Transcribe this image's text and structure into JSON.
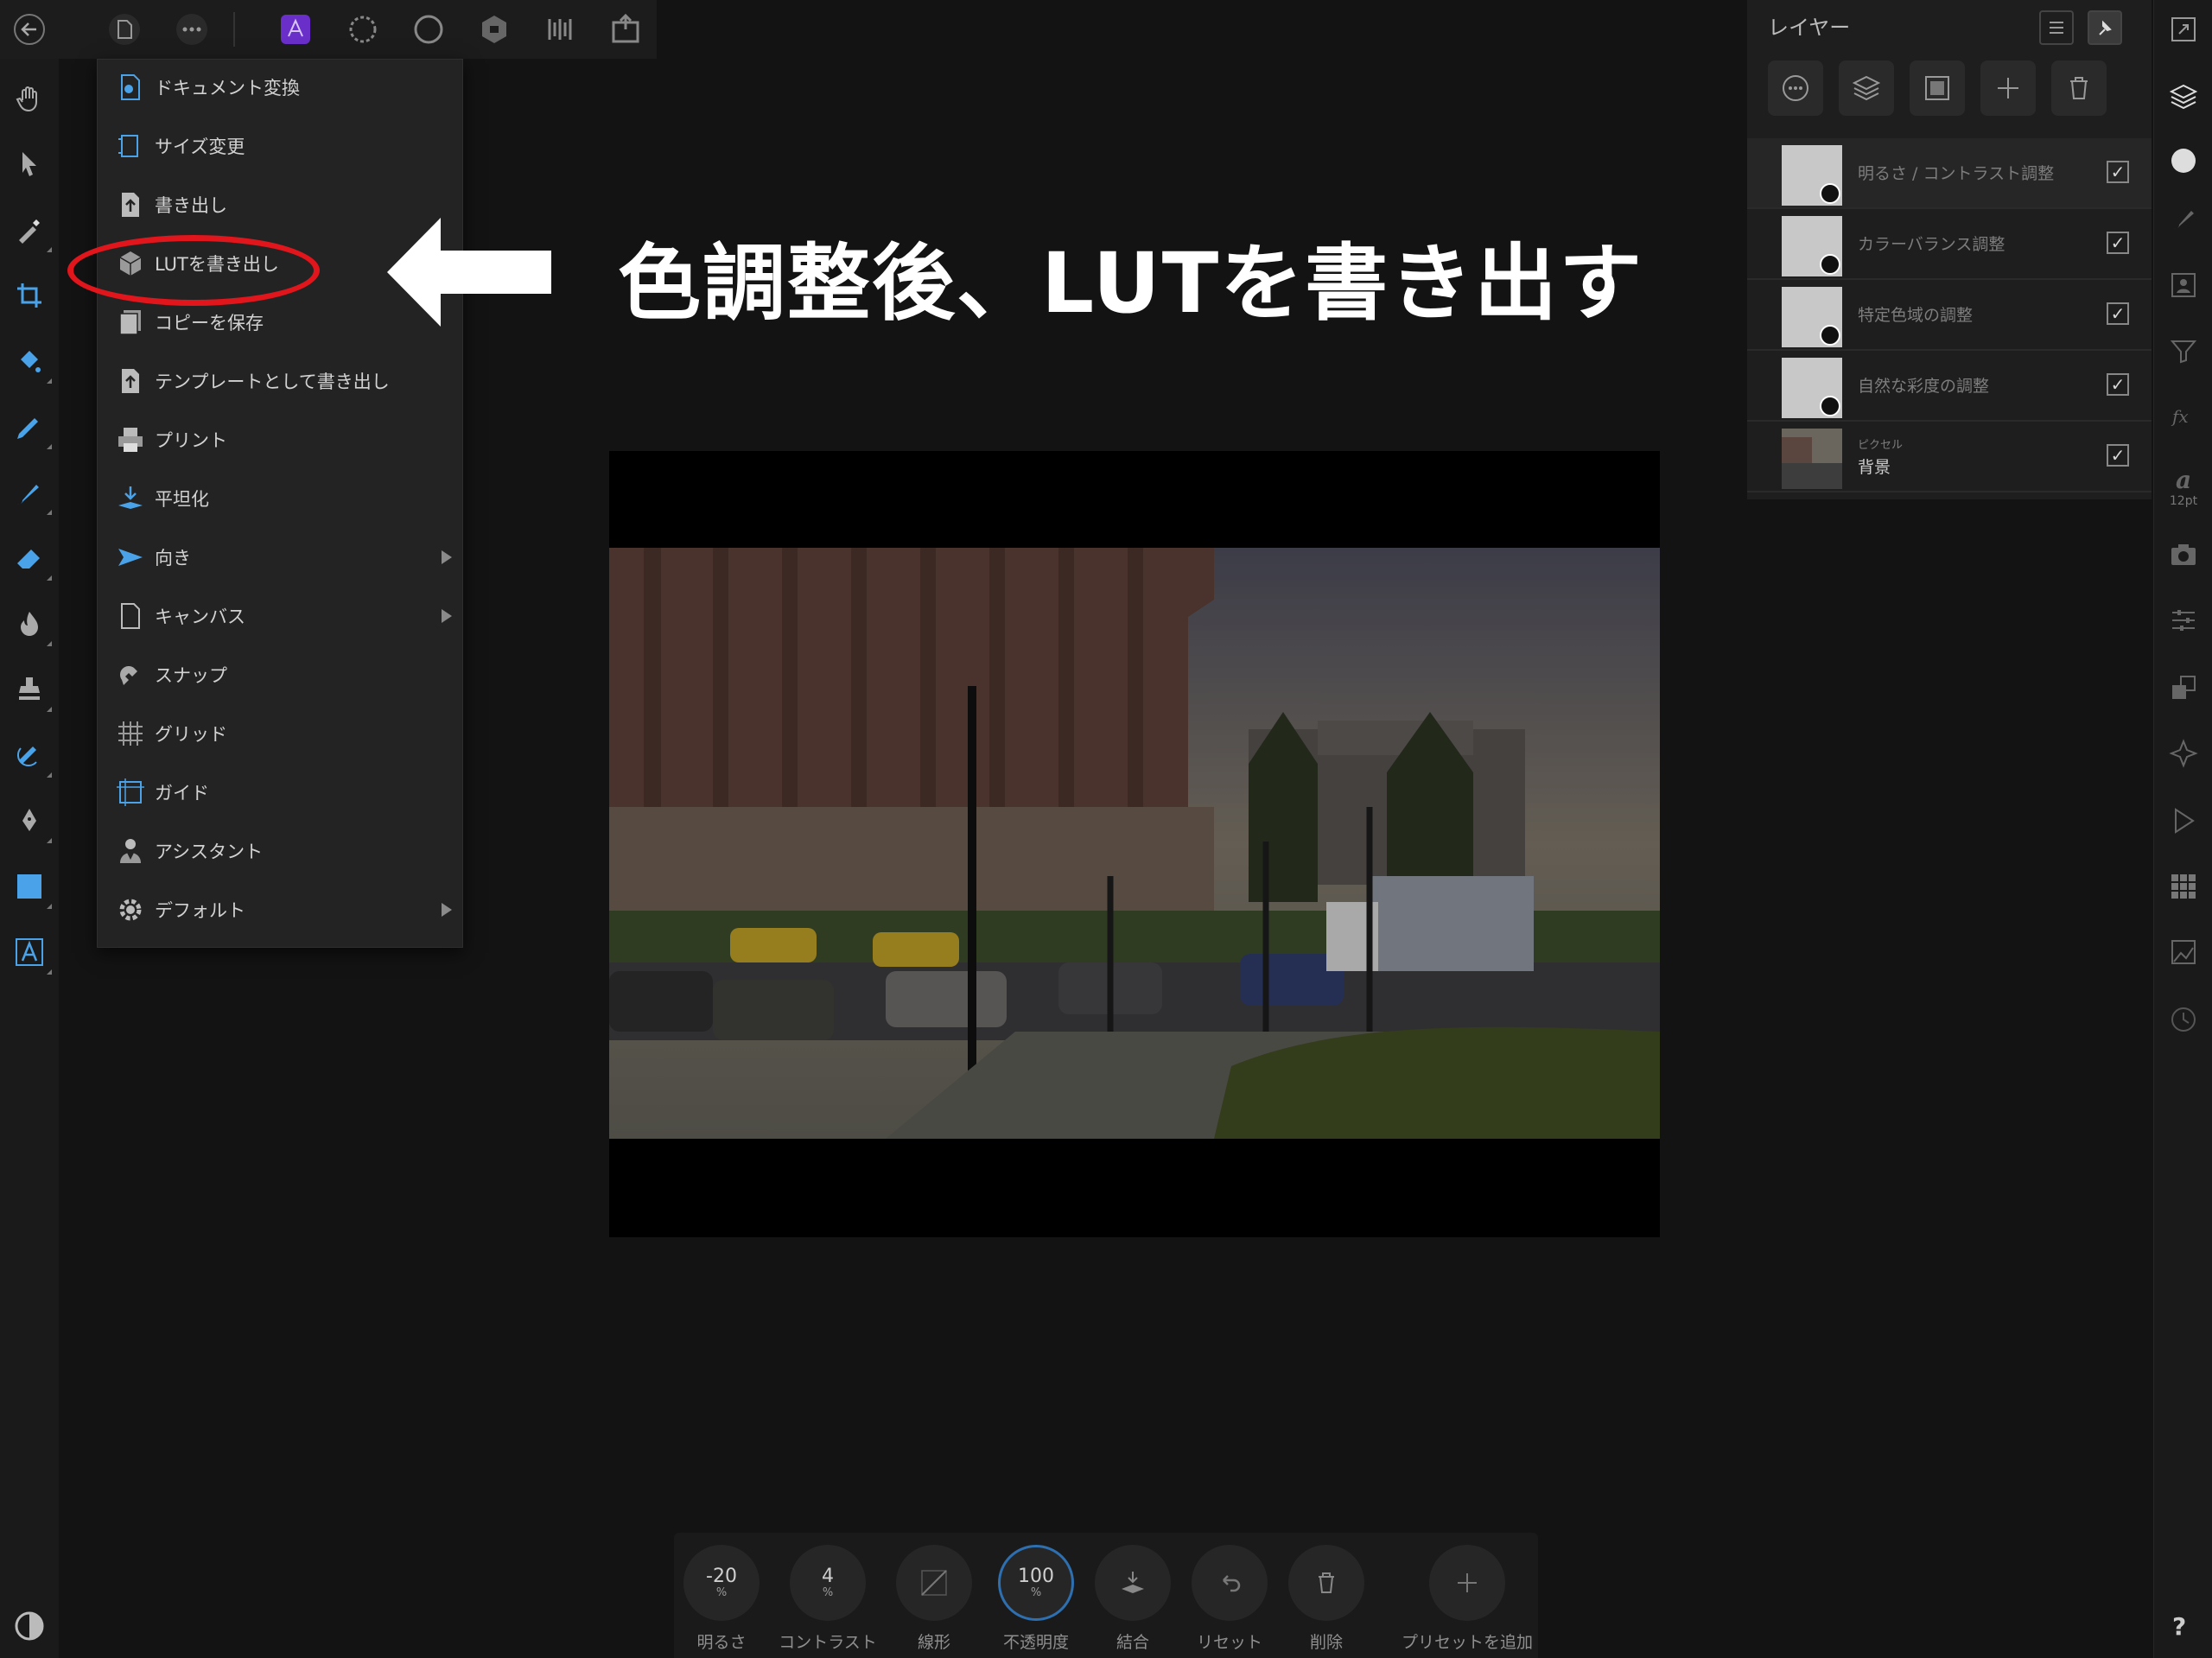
{
  "annotation": {
    "text": "色調整後、LUTを書き出す",
    "circle_color": "#e0161c",
    "arrow_color": "#ffffff"
  },
  "top_toolbar": {
    "items": [
      "back-arrow-icon",
      "document-icon",
      "more-icon",
      "photo-persona-icon",
      "liquify-persona-icon",
      "develop-persona-icon",
      "tone-mapping-persona-icon",
      "export-persona-icon",
      "share-icon"
    ],
    "accent_color": "#7b3fd0"
  },
  "document_menu": {
    "items": [
      {
        "label": "ドキュメント変換",
        "icon": "convert-document-icon",
        "submenu": false
      },
      {
        "label": "サイズ変更",
        "icon": "resize-icon",
        "submenu": false
      },
      {
        "label": "書き出し",
        "icon": "export-icon",
        "submenu": false
      },
      {
        "label": "LUTを書き出し",
        "icon": "lut-cube-icon",
        "submenu": false
      },
      {
        "label": "コピーを保存",
        "icon": "save-copy-icon",
        "submenu": false
      },
      {
        "label": "テンプレートとして書き出し",
        "icon": "export-template-icon",
        "submenu": false
      },
      {
        "label": "プリント",
        "icon": "printer-icon",
        "submenu": false
      },
      {
        "label": "平坦化",
        "icon": "flatten-icon",
        "submenu": false
      },
      {
        "label": "向き",
        "icon": "orientation-icon",
        "submenu": true
      },
      {
        "label": "キャンバス",
        "icon": "canvas-icon",
        "submenu": true
      },
      {
        "label": "スナップ",
        "icon": "snap-icon",
        "submenu": false
      },
      {
        "label": "グリッド",
        "icon": "grid-icon",
        "submenu": false
      },
      {
        "label": "ガイド",
        "icon": "guides-icon",
        "submenu": false
      },
      {
        "label": "アシスタント",
        "icon": "assistant-icon",
        "submenu": false
      },
      {
        "label": "デフォルト",
        "icon": "gear-icon",
        "submenu": true
      }
    ]
  },
  "layers_panel": {
    "title": "レイヤー",
    "layers": [
      {
        "name": "明るさ / コントラスト調整",
        "kind": "adjustment",
        "visible": true,
        "selected": true
      },
      {
        "name": "カラーバランス調整",
        "kind": "adjustment",
        "visible": true,
        "selected": false
      },
      {
        "name": "特定色域の調整",
        "kind": "adjustment",
        "visible": true,
        "selected": false
      },
      {
        "name": "自然な彩度の調整",
        "kind": "adjustment",
        "visible": true,
        "selected": false
      },
      {
        "name": "背景",
        "type_label": "ピクセル",
        "kind": "pixel",
        "visible": true,
        "selected": false
      }
    ],
    "checkmark": "✓"
  },
  "right_studio": {
    "text_size_label": "12pt",
    "help_label": "?"
  },
  "context_toolbar": {
    "items": [
      {
        "value": "-20",
        "unit": "%",
        "label": "明るさ",
        "active": false
      },
      {
        "value": "4",
        "unit": "%",
        "label": "コントラスト",
        "active": false
      },
      {
        "value": "",
        "unit": "",
        "label": "線形",
        "active": false
      },
      {
        "value": "100",
        "unit": "%",
        "label": "不透明度",
        "active": true
      },
      {
        "value": "",
        "unit": "",
        "label": "結合",
        "active": false
      },
      {
        "value": "",
        "unit": "",
        "label": "リセット",
        "active": false
      },
      {
        "value": "",
        "unit": "",
        "label": "削除",
        "active": false
      },
      {
        "value": "",
        "unit": "",
        "label": "プリセットを追加",
        "active": false
      }
    ]
  }
}
